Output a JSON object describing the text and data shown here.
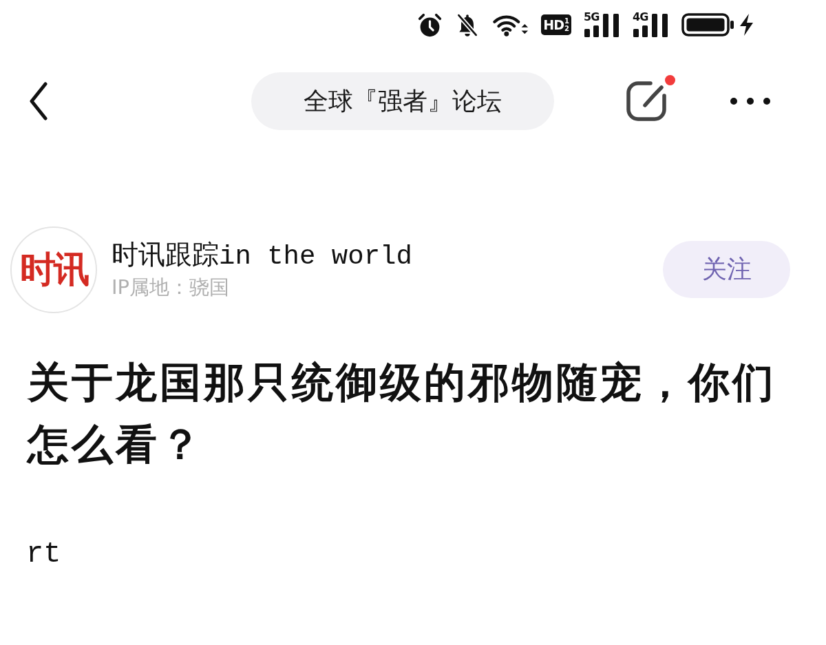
{
  "status_bar": {
    "hd_label": "HD",
    "hd_slots": [
      "1",
      "2"
    ],
    "signals": [
      {
        "label": "5G"
      },
      {
        "label": "4G"
      }
    ]
  },
  "nav": {
    "title": "全球『强者』论坛",
    "edit_has_badge": true
  },
  "author": {
    "avatar_text": "时讯",
    "name": "时讯跟踪in the world",
    "ip_location": "IP属地：骁国",
    "follow_button": "关注"
  },
  "post": {
    "title": "关于龙国那只统御级的邪物随宠，你们怎么看？",
    "body": "rt"
  }
}
